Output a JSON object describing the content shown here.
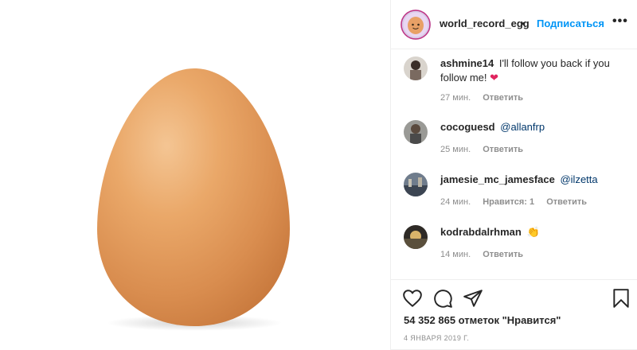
{
  "post": {
    "image_alt_name": "egg-photo",
    "username": "world_record_egg",
    "separator": "•",
    "follow_label": "Подписаться",
    "more_label": "•••"
  },
  "comments": [
    {
      "username": "ashmine14",
      "text": "I'll follow you back if you follow me!",
      "emoji": "❤",
      "time": "27 мин.",
      "reply_label": "Ответить"
    },
    {
      "username": "cocoguesd",
      "mention": "@allanfrp",
      "time": "25 мин.",
      "reply_label": "Ответить"
    },
    {
      "username": "jamesie_mc_jamesface",
      "mention": "@ilzetta",
      "time": "24 мин.",
      "likes_label": "Нравится: 1",
      "reply_label": "Ответить"
    },
    {
      "username": "kodrabdalrhman",
      "emoji": "👏",
      "time": "14 мин.",
      "reply_label": "Ответить"
    }
  ],
  "footer": {
    "likes_text": "54 352 865 отметок \"Нравится\"",
    "date": "4 ЯНВАРЯ 2019 Г.",
    "icons": [
      "heart-icon",
      "comment-icon",
      "share-icon",
      "bookmark-icon"
    ]
  },
  "colors": {
    "accent": "#0095f6",
    "mention": "#00376b",
    "muted": "#8e8e8e",
    "egg": "#e8a066"
  }
}
